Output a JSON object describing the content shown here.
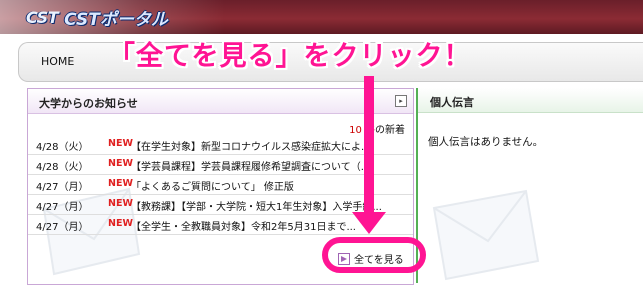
{
  "header": {
    "logo_brand": "CST",
    "logo_title": "CSTポータル"
  },
  "nav": {
    "home_label": "HOME"
  },
  "annotation": {
    "text": "「全てを見る」をクリック！",
    "color": "#ff1493"
  },
  "news_panel": {
    "title": "大学からのお知らせ",
    "count_value": "10 件",
    "count_label": "の新着",
    "see_all_label": "全てを見る",
    "items": [
      {
        "date": "4/28（火）",
        "tag": "NEW",
        "title": "【在学生対象】新型コロナウイルス感染症拡大によ..."
      },
      {
        "date": "4/28（火）",
        "tag": "NEW",
        "title": "【学芸員課程】学芸員課程履修希望調査について（..."
      },
      {
        "date": "4/27（月）",
        "tag": "NEW",
        "title": "「よくあるご質問について」 修正版"
      },
      {
        "date": "4/27（月）",
        "tag": "NEW",
        "title": "【教務課】【学部・大学院・短大1年生対象】入学手続..."
      },
      {
        "date": "4/27（月）",
        "tag": "NEW",
        "title": "【全学生・全教職員対象】令和2年5月31日まで..."
      }
    ]
  },
  "memo_panel": {
    "title": "個人伝言",
    "body": "個人伝言はありません。"
  },
  "colors": {
    "brand_bar": "#8b2b34",
    "new_tag": "#e02020",
    "count": "#cc0000",
    "news_border": "#c9a7d6",
    "memo_border": "#55b055"
  }
}
